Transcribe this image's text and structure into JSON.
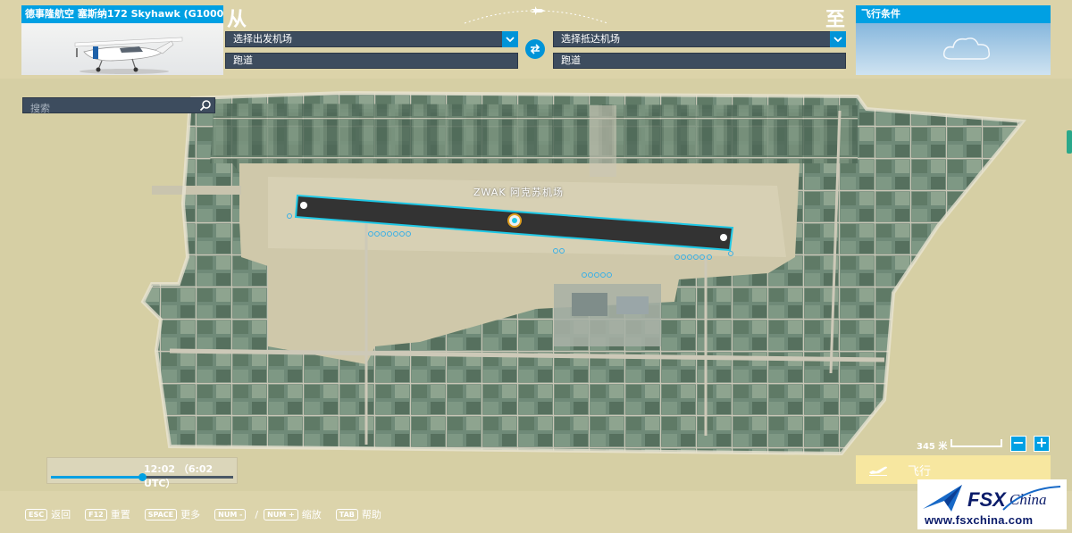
{
  "aircraft": {
    "title": "德事隆航空 塞斯纳172 Skyhawk (G1000)"
  },
  "route": {
    "from_label": "从",
    "to_label": "至",
    "departure_placeholder": "选择出发机场",
    "arrival_placeholder": "选择抵达机场",
    "departure_runway": "跑道",
    "arrival_runway": "跑道"
  },
  "conditions": {
    "title": "飞行条件"
  },
  "map": {
    "search_placeholder": "搜索",
    "airport_label": "ZWAK 阿克苏机场",
    "scale_label": "345 米",
    "zoom_out": "−",
    "zoom_in": "+"
  },
  "time": {
    "display": "12:02 （6:02 UTC）",
    "slider_fraction": 0.5
  },
  "fly": {
    "label": "飞行"
  },
  "hints": [
    {
      "key": "ESC",
      "label": "返回"
    },
    {
      "key": "F12",
      "label": "重置"
    },
    {
      "key": "SPACE",
      "label": "更多"
    },
    {
      "key": "NUM -",
      "label": ""
    },
    {
      "key": "NUM +",
      "label": "缩放"
    },
    {
      "key": "TAB",
      "label": "帮助"
    }
  ],
  "hint_separator": "/",
  "watermark": {
    "brand": "FSX China",
    "url": "www.fsxchina.com"
  },
  "colors": {
    "accent": "#00a0e3",
    "panel": "#3d4c5e",
    "runway": "#333333",
    "runway_outline": "#1ec8e6",
    "fly_button": "#f7e7a0"
  },
  "icons": [
    "chevron-down-icon",
    "swap-icon",
    "search-icon",
    "plane-icon",
    "cloud-icon",
    "takeoff-icon"
  ]
}
